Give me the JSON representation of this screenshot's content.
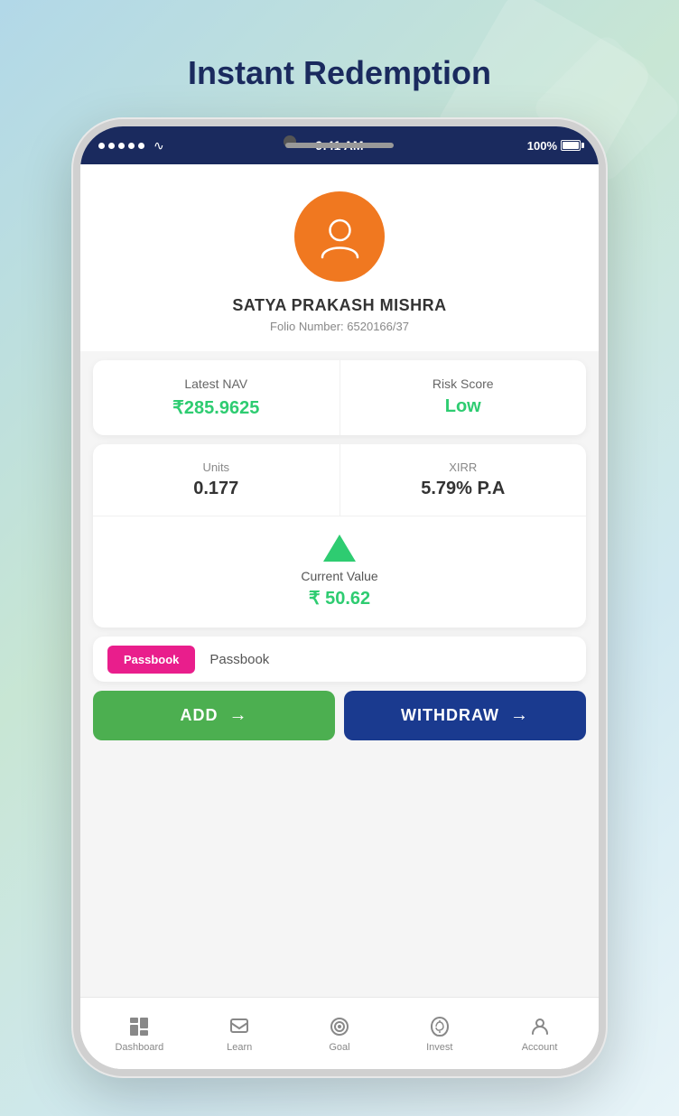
{
  "page": {
    "title": "Instant Redemption",
    "background_gradient": "linear-gradient(135deg, #b2d8e8, #c8e6d4, #d0e8f0)"
  },
  "status_bar": {
    "time": "9:41 AM",
    "battery": "100%",
    "signal_dots": 5
  },
  "profile": {
    "name": "SATYA PRAKASH MISHRA",
    "folio_label": "Folio Number: 6520166/37",
    "avatar_color": "#f07820"
  },
  "stats": {
    "nav_label": "Latest NAV",
    "nav_value": "₹285.9625",
    "risk_label": "Risk Score",
    "risk_value": "Low",
    "units_label": "Units",
    "units_value": "0.177",
    "xirr_label": "XIRR",
    "xirr_value": "5.79% P.A",
    "current_value_label": "Current Value",
    "current_value": "₹ 50.62"
  },
  "passbook": {
    "tab_label": "Passbook"
  },
  "buttons": {
    "add_label": "ADD",
    "withdraw_label": "WITHDRAW"
  },
  "bottom_nav": {
    "items": [
      {
        "id": "dashboard",
        "label": "Dashboard"
      },
      {
        "id": "learn",
        "label": "Learn"
      },
      {
        "id": "goal",
        "label": "Goal"
      },
      {
        "id": "invest",
        "label": "Invest"
      },
      {
        "id": "account",
        "label": "Account"
      }
    ]
  }
}
